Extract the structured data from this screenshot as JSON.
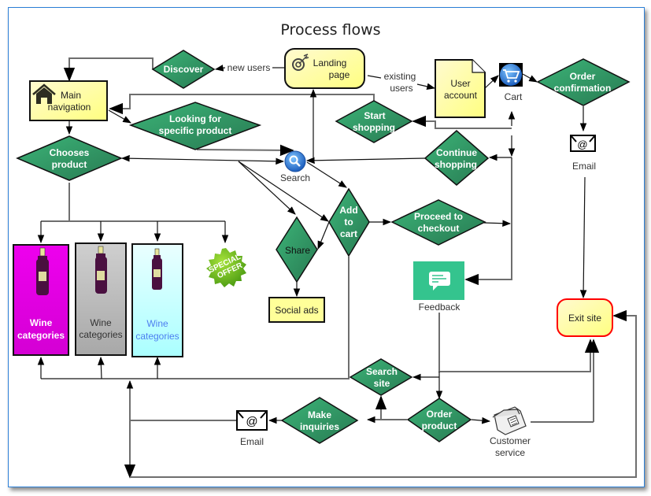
{
  "title": "Process flows",
  "colors": {
    "decision_fill_light": "#3aaa72",
    "decision_fill_dark": "#2a7d55",
    "note_fill": "#ffff99",
    "exit_border": "#ff0000",
    "frame_border": "#2b7fd6",
    "feedback_fill": "#34c48e",
    "wine_magenta": "#e000e0",
    "wine_gray": "#b0b0b0",
    "wine_cyan": "#b8ffff",
    "connector": "#6e6e6e"
  },
  "nodes": {
    "landing_page": {
      "line1": "Landing",
      "line2": "page",
      "icon": "target-icon"
    },
    "discover": {
      "label": "Discover"
    },
    "main_navigation": {
      "line1": "Main",
      "line2": "navigation",
      "icon": "home-icon"
    },
    "user_account": {
      "line1": "User",
      "line2": "account"
    },
    "cart": {
      "label": "Cart",
      "icon": "cart-icon"
    },
    "order_confirmation": {
      "line1": "Order",
      "line2": "confirmation"
    },
    "email_top": {
      "label": "Email",
      "icon": "email-icon"
    },
    "looking_for": {
      "line1": "Looking  for",
      "line2": "specific product"
    },
    "start_shopping": {
      "line1": "Start",
      "line2": "shopping"
    },
    "chooses_product": {
      "line1": "Chooses",
      "line2": "product"
    },
    "search": {
      "label": "Search",
      "icon": "search-icon"
    },
    "continue_shopping": {
      "line1": "Continue",
      "line2": "shopping"
    },
    "add_to_cart": {
      "line1": "Add",
      "line2": "to",
      "line3": "cart"
    },
    "proceed_checkout": {
      "line1": "Proceed  to",
      "line2": "checkout"
    },
    "share": {
      "label": "Share"
    },
    "social_ads": {
      "label": "Social ads"
    },
    "wine_1": {
      "line1": "Wine",
      "line2": "categories"
    },
    "wine_2": {
      "line1": "Wine",
      "line2": "categories"
    },
    "wine_3": {
      "line1": "Wine",
      "line2": "categories"
    },
    "special_offer": {
      "line1": "SPECIAL",
      "line2": "OFFER"
    },
    "feedback": {
      "label": "Feedback",
      "icon": "chat-bubble-icon"
    },
    "exit_site": {
      "label": "Exit site"
    },
    "search_site": {
      "line1": "Search",
      "line2": "site"
    },
    "make_inquiries": {
      "line1": "Make",
      "line2": "inquiries"
    },
    "order_product": {
      "line1": "Order",
      "line2": "product"
    },
    "email_bottom": {
      "label": "Email",
      "icon": "email-icon"
    },
    "customer_service": {
      "line1": "Customer",
      "line2": "service",
      "icon": "telephone-icon"
    }
  },
  "edge_labels": {
    "new_users": "new users",
    "existing_line1": "existing",
    "existing_line2": "users"
  }
}
